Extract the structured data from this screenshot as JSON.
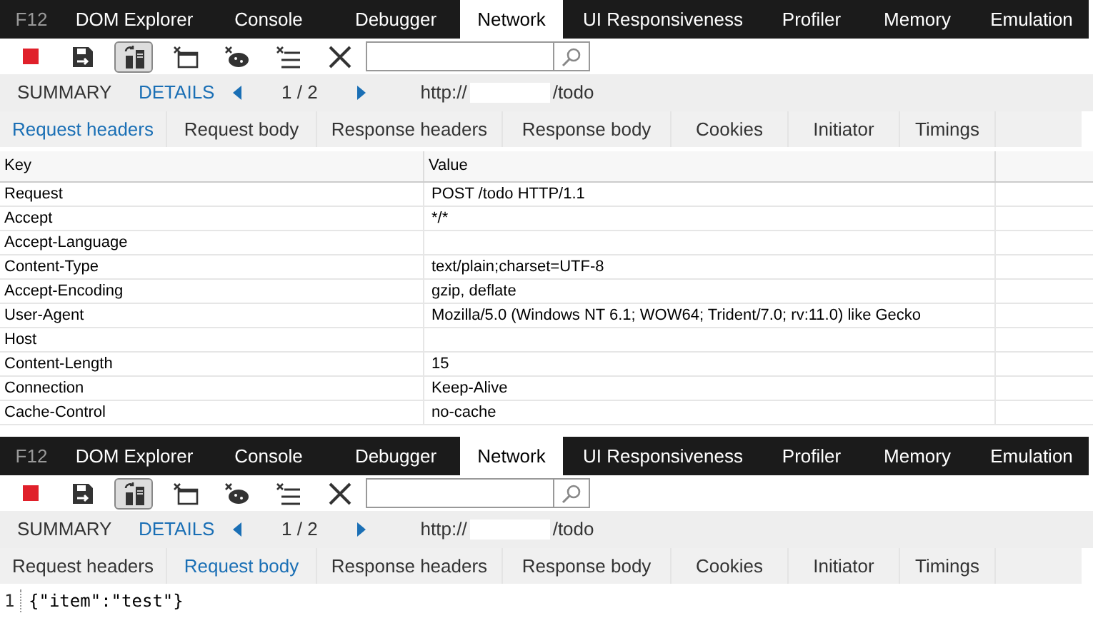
{
  "panels": [
    {
      "main_tabs": [
        {
          "label": "F12",
          "kind": "logo",
          "selected": false
        },
        {
          "label": "DOM Explorer",
          "selected": false
        },
        {
          "label": "Console",
          "selected": false
        },
        {
          "label": "Debugger",
          "selected": false
        },
        {
          "label": "Network",
          "selected": true
        },
        {
          "label": "UI Responsiveness",
          "selected": false
        },
        {
          "label": "Profiler",
          "selected": false
        },
        {
          "label": "Memory",
          "selected": false
        },
        {
          "label": "Emulation",
          "selected": false
        }
      ],
      "tools": [
        {
          "kind": "stop",
          "pressed": false
        },
        {
          "kind": "export",
          "pressed": false
        },
        {
          "kind": "always-refresh",
          "pressed": true
        },
        {
          "kind": "clear-entries",
          "pressed": false
        },
        {
          "kind": "clear-cache",
          "pressed": false
        },
        {
          "kind": "clear-list",
          "pressed": false
        },
        {
          "kind": "clear",
          "pressed": false
        }
      ],
      "details_bar": {
        "views": [
          {
            "label": "SUMMARY",
            "selected": false
          },
          {
            "label": "DETAILS",
            "selected": true
          }
        ],
        "page": "1 / 2",
        "url_start": "http://",
        "url_end": "/todo"
      },
      "sub_tabs": [
        {
          "label": "Request headers",
          "selected": true
        },
        {
          "label": "Request body",
          "selected": false
        },
        {
          "label": "Response headers",
          "selected": false
        },
        {
          "label": "Response body",
          "selected": false
        },
        {
          "label": "Cookies",
          "selected": false
        },
        {
          "label": "Initiator",
          "selected": false
        },
        {
          "label": "Timings",
          "selected": false
        }
      ],
      "content": {
        "kind": "table",
        "columns": [
          "Key",
          "Value"
        ],
        "rows": [
          {
            "key": "Request",
            "value": "POST /todo HTTP/1.1"
          },
          {
            "key": "Accept",
            "value": "*/*"
          },
          {
            "key": "Accept-Language"
          },
          {
            "key": "Content-Type",
            "value": "text/plain;charset=UTF-8"
          },
          {
            "key": "Accept-Encoding",
            "value": "gzip, deflate"
          },
          {
            "key": "User-Agent",
            "value": "Mozilla/5.0 (Windows NT 6.1; WOW64; Trident/7.0; rv:11.0) like Gecko"
          },
          {
            "key": "Host"
          },
          {
            "key": "Content-Length",
            "value": "15"
          },
          {
            "key": "Connection",
            "value": "Keep-Alive"
          },
          {
            "key": "Cache-Control",
            "value": "no-cache"
          }
        ]
      }
    },
    {
      "main_tabs": [
        {
          "label": "F12",
          "kind": "logo",
          "selected": false
        },
        {
          "label": "DOM Explorer",
          "selected": false
        },
        {
          "label": "Console",
          "selected": false
        },
        {
          "label": "Debugger",
          "selected": false
        },
        {
          "label": "Network",
          "selected": true
        },
        {
          "label": "UI Responsiveness",
          "selected": false
        },
        {
          "label": "Profiler",
          "selected": false
        },
        {
          "label": "Memory",
          "selected": false
        },
        {
          "label": "Emulation",
          "selected": false
        }
      ],
      "tools": [
        {
          "kind": "stop",
          "pressed": false
        },
        {
          "kind": "export",
          "pressed": false
        },
        {
          "kind": "always-refresh",
          "pressed": true
        },
        {
          "kind": "clear-entries",
          "pressed": false
        },
        {
          "kind": "clear-cache",
          "pressed": false
        },
        {
          "kind": "clear-list",
          "pressed": false
        },
        {
          "kind": "clear",
          "pressed": false
        }
      ],
      "details_bar": {
        "views": [
          {
            "label": "SUMMARY",
            "selected": false
          },
          {
            "label": "DETAILS",
            "selected": true
          }
        ],
        "page": "1 / 2",
        "url_start": "http://",
        "url_end": "/todo"
      },
      "sub_tabs": [
        {
          "label": "Request headers",
          "selected": false
        },
        {
          "label": "Request body",
          "selected": true
        },
        {
          "label": "Response headers",
          "selected": false
        },
        {
          "label": "Response body",
          "selected": false
        },
        {
          "label": "Cookies",
          "selected": false
        },
        {
          "label": "Initiator",
          "selected": false
        },
        {
          "label": "Timings",
          "selected": false
        }
      ],
      "content": {
        "kind": "code",
        "lines": [
          {
            "number": "1",
            "text": "{\"item\":\"test\"}"
          }
        ]
      }
    }
  ]
}
